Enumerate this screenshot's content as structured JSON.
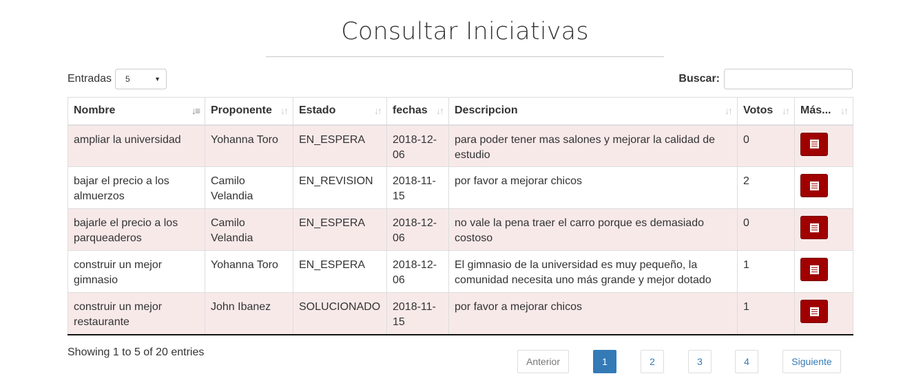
{
  "page": {
    "title": "Consultar Iniciativas"
  },
  "controls": {
    "entries_label": "Entradas",
    "entries_value": "5",
    "search_label": "Buscar:",
    "search_value": ""
  },
  "table": {
    "columns": [
      "Nombre",
      "Proponente",
      "Estado",
      "fechas",
      "Descripcion",
      "Votos",
      "Más..."
    ],
    "rows": [
      {
        "nombre": "ampliar la universidad",
        "proponente": "Yohanna Toro",
        "estado": "EN_ESPERA",
        "fecha": "2018-12-06",
        "descripcion": "para poder tener mas salones y mejorar la calidad de estudio",
        "votos": "0"
      },
      {
        "nombre": "bajar el precio a los almuerzos",
        "proponente": "Camilo Velandia",
        "estado": "EN_REVISION",
        "fecha": "2018-11-15",
        "descripcion": "por favor a mejorar chicos",
        "votos": "2"
      },
      {
        "nombre": "bajarle el precio a los parqueaderos",
        "proponente": "Camilo Velandia",
        "estado": "EN_ESPERA",
        "fecha": "2018-12-06",
        "descripcion": "no vale la pena traer el carro porque es demasiado costoso",
        "votos": "0"
      },
      {
        "nombre": "construir un mejor gimnasio",
        "proponente": "Yohanna Toro",
        "estado": "EN_ESPERA",
        "fecha": "2018-12-06",
        "descripcion": "El gimnasio de la universidad es muy pequeño, la comunidad necesita uno más grande y mejor dotado",
        "votos": "1"
      },
      {
        "nombre": "construir un mejor restaurante",
        "proponente": "John Ibanez",
        "estado": "SOLUCIONADO",
        "fecha": "2018-11-15",
        "descripcion": "por favor a mejorar chicos",
        "votos": "1"
      }
    ],
    "sorted_column": "Nombre",
    "sort_direction": "ascending",
    "more_button_icon": "list-alt-icon",
    "row_highlight_color": "#f8e9e9",
    "button_color": "#a00000"
  },
  "footer": {
    "info": "Showing 1 to 5 of 20 entries",
    "pagination": {
      "previous": "Anterior",
      "pages": [
        "1",
        "2",
        "3",
        "4"
      ],
      "current": "1",
      "next": "Siguiente",
      "active_color": "#337ab7"
    }
  }
}
